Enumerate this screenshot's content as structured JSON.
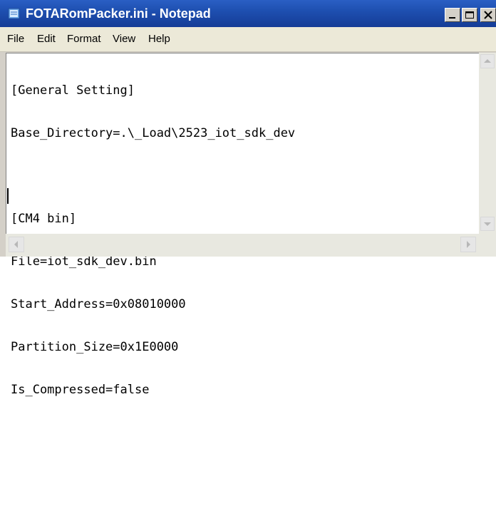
{
  "window": {
    "title": "FOTARomPacker.ini - Notepad",
    "icon": "notepad-icon",
    "controls": [
      "minimize-icon",
      "maximize-icon",
      "close-icon"
    ]
  },
  "menu": {
    "items": [
      "File",
      "Edit",
      "Format",
      "View",
      "Help"
    ]
  },
  "editor": {
    "lines": [
      "[General Setting]",
      "Base_Directory=.\\_Load\\2523_iot_sdk_dev",
      "",
      "[CM4 bin]",
      "File=iot_sdk_dev.bin",
      "Start_Address=0x08010000",
      "Partition_Size=0x1E0000",
      "Is_Compressed=false",
      "",
      ""
    ]
  },
  "colors": {
    "titlebar": "#1e4fb0",
    "title_text": "#ffffff",
    "menubar": "#ece9d8",
    "editor_bg": "#ffffff"
  }
}
